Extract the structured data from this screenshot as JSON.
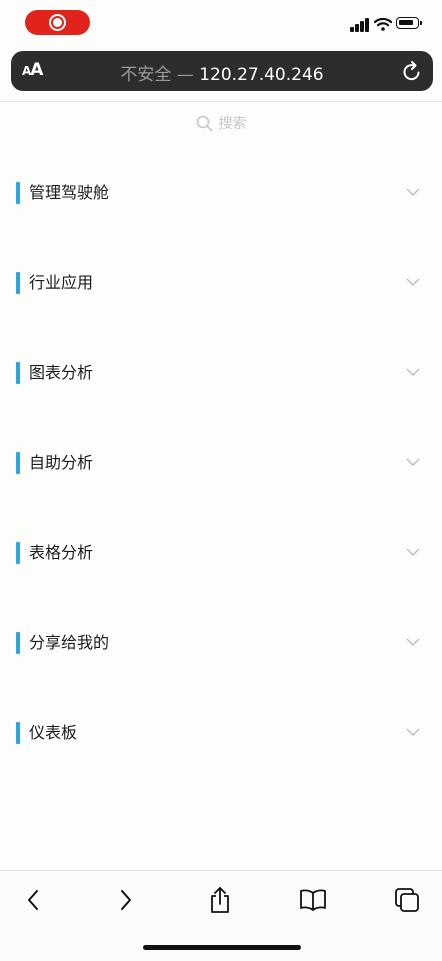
{
  "browser": {
    "aa_small": "A",
    "aa_large": "A",
    "insecure_label": "不安全",
    "separator": " — ",
    "address": "120.27.40.246"
  },
  "search": {
    "placeholder": "搜索"
  },
  "menu": {
    "items": [
      {
        "label": "管理驾驶舱"
      },
      {
        "label": "行业应用"
      },
      {
        "label": "图表分析"
      },
      {
        "label": "自助分析"
      },
      {
        "label": "表格分析"
      },
      {
        "label": "分享给我的"
      },
      {
        "label": "仪表板"
      }
    ]
  },
  "colors": {
    "accent": "#2aa7df",
    "recording": "#e0241b",
    "address_bar": "#2d2d2d"
  },
  "toolbar": {
    "icons": [
      "back-icon",
      "forward-icon",
      "share-icon",
      "bookmarks-icon",
      "tabs-icon"
    ]
  }
}
